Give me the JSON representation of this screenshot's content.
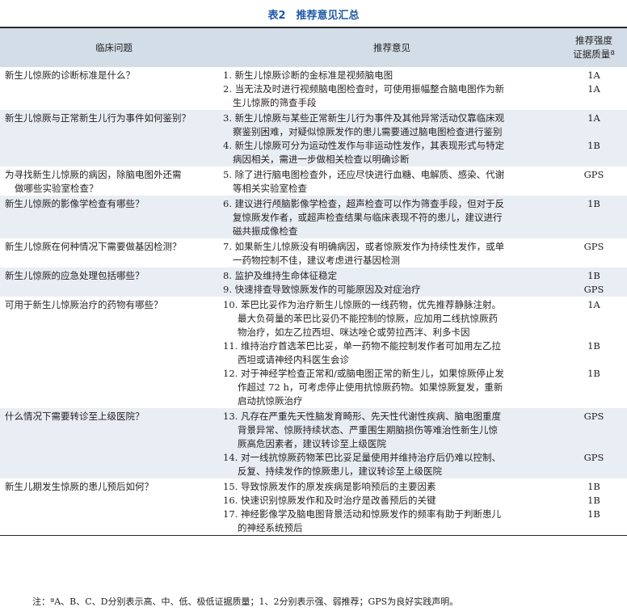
{
  "caption": "表2　推荐意见汇总",
  "headers": {
    "question": "临床问题",
    "recommendation": "推荐意见",
    "grade_line1": "推荐强度",
    "grade_line2": "证据质量ª"
  },
  "rows": [
    {
      "shaded": false,
      "question_lines": [
        "新生儿惊厥的诊断标准是什么？"
      ],
      "recs": [
        {
          "lines": [
            "1. 新生儿惊厥诊断的金标准是视频脑电图"
          ],
          "grade": "1A"
        },
        {
          "lines": [
            "2. 当无法及时进行视频脑电图检查时，可使用振幅整合脑电图作为新",
            "生儿惊厥的筛查手段"
          ],
          "grade": "1A"
        }
      ]
    },
    {
      "shaded": true,
      "question_lines": [
        "新生儿惊厥与正常新生儿行为事件如何鉴别？"
      ],
      "recs": [
        {
          "lines": [
            "3. 新生儿惊厥与某些正常新生儿行为事件及其他异常活动仅靠临床观",
            "察鉴别困难，对疑似惊厥发作的患儿需要通过脑电图检查进行鉴别"
          ],
          "grade": "1A"
        },
        {
          "lines": [
            "4. 新生儿惊厥可分为运动性发作与非运动性发作，其表现形式与特定",
            "病因相关，需进一步做相关检查以明确诊断"
          ],
          "grade": "1B"
        }
      ]
    },
    {
      "shaded": false,
      "question_lines": [
        "为寻找新生儿惊厥的病因，除脑电图外还需",
        "做哪些实验室检查？"
      ],
      "recs": [
        {
          "lines": [
            "5. 除了进行脑电图检查外，还应尽快进行血糖、电解质、感染、代谢",
            "等相关实验室检查"
          ],
          "grade": "GPS"
        }
      ]
    },
    {
      "shaded": true,
      "question_lines": [
        "新生儿惊厥的影像学检查有哪些？"
      ],
      "recs": [
        {
          "lines": [
            "6. 建议进行颅脑影像学检查，超声检查可以作为筛查手段，但对于反",
            "复惊厥发作者，或超声检查结果与临床表现不符的患儿，建议进行",
            "磁共振成像检查"
          ],
          "grade": "1B"
        }
      ]
    },
    {
      "shaded": false,
      "question_lines": [
        "新生儿惊厥在何种情况下需要做基因检测？"
      ],
      "recs": [
        {
          "lines": [
            "7. 如果新生儿惊厥没有明确病因，或者惊厥发作为持续性发作，或单",
            "一药物控制不佳，建议考虑进行基因检测"
          ],
          "grade": "GPS"
        }
      ]
    },
    {
      "shaded": true,
      "question_lines": [
        "新生儿惊厥的应急处理包括哪些？"
      ],
      "recs": [
        {
          "lines": [
            "8. 监护及维持生命体征稳定"
          ],
          "grade": "1B"
        },
        {
          "lines": [
            "9. 快速排查导致惊厥发作的可能原因及对症治疗"
          ],
          "grade": "GPS"
        }
      ]
    },
    {
      "shaded": false,
      "question_lines": [
        "可用于新生儿惊厥治疗的药物有哪些？"
      ],
      "recs": [
        {
          "lines": [
            "10. 苯巴比妥作为治疗新生儿惊厥的一线药物，优先推荐静脉注射。",
            "最大负荷量的苯巴比妥仍不能控制的惊厥，应加用二线抗惊厥药",
            "物治疗，如左乙拉西坦、咪达唑仑或劳拉西泮、利多卡因"
          ],
          "grade": "1A"
        },
        {
          "lines": [
            "11. 维持治疗首选苯巴比妥，单一药物不能控制发作者可加用左乙拉",
            "西坦或请神经内科医生会诊"
          ],
          "grade": "1B"
        },
        {
          "lines": [
            "12. 对于神经学检查正常和/或脑电图正常的新生儿，如果惊厥停止发",
            "作超过 72 h，可考虑停止使用抗惊厥药物。如果惊厥复发，重新",
            "启动抗惊厥治疗"
          ],
          "grade": "1B"
        }
      ]
    },
    {
      "shaded": true,
      "question_lines": [
        "什么情况下需要转诊至上级医院？"
      ],
      "recs": [
        {
          "lines": [
            "13. 凡存在严重先天性脑发育畸形、先天性代谢性疾病、脑电图重度",
            "背景异常、惊厥持续状态、严重围生期脑损伤等难治性新生儿惊",
            "厥高危因素者，建议转诊至上级医院"
          ],
          "grade": "GPS"
        },
        {
          "lines": [
            "14. 对一线抗惊厥药物苯巴比妥足量使用并维持治疗后仍难以控制、",
            "反复、持续发作的惊厥患儿，建议转诊至上级医院"
          ],
          "grade": "GPS"
        }
      ]
    },
    {
      "shaded": false,
      "question_lines": [
        "新生儿期发生惊厥的患儿预后如何？"
      ],
      "recs": [
        {
          "lines": [
            "15. 导致惊厥发作的原发疾病是影响预后的主要因素"
          ],
          "grade": "1B"
        },
        {
          "lines": [
            "16. 快速识别惊厥发作和及时治疗是改善预后的关键"
          ],
          "grade": "1B"
        },
        {
          "lines": [
            "17. 神经影像学及脑电图背景活动和惊厥发作的频率有助于判断患儿",
            "的神经系统预后"
          ],
          "grade": "1B"
        }
      ]
    }
  ],
  "note": "注：ªA、B、C、D分别表示高、中、低、极低证据质量；1、2分别表示强、弱推荐；GPS为良好实践声明。"
}
